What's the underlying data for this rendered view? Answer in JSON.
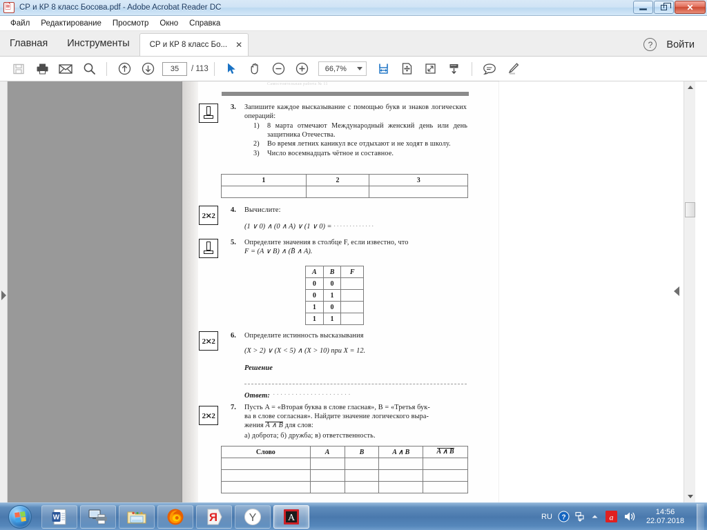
{
  "window": {
    "title": "СР и КР 8 класс Босова.pdf - Adobe Acrobat Reader DC",
    "app_icon": "pdf-document-icon",
    "minimize_label": "",
    "restore_label": "",
    "close_label": "✕"
  },
  "menu": {
    "items": [
      {
        "label": "Файл"
      },
      {
        "label": "Редактирование"
      },
      {
        "label": "Просмотр"
      },
      {
        "label": "Окно"
      },
      {
        "label": "Справка"
      }
    ]
  },
  "tabstrip": {
    "home_label": "Главная",
    "tools_label": "Инструменты",
    "document_tab_label": "СР и КР 8 класс Бо...",
    "document_tab_close": "✕",
    "help_label": "?",
    "signin_label": "Войти"
  },
  "toolbar": {
    "save_icon": "floppy-save-icon",
    "print_icon": "printer-icon",
    "email_icon": "envelope-icon",
    "search_icon": "magnifier-icon",
    "prev_page_icon": "arrow-up-circle-icon",
    "next_page_icon": "arrow-down-circle-icon",
    "page_number": "35",
    "page_total": "/ 113",
    "select_tool_icon": "cursor-arrow-icon",
    "hand_tool_icon": "hand-icon",
    "zoom_out_icon": "minus-circle-icon",
    "zoom_in_icon": "plus-circle-icon",
    "zoom_value": "66,7%",
    "zoom_caret_icon": "chevron-down-icon",
    "fit_width_icon": "fit-width-icon",
    "pan_page_icon": "pan-page-icon",
    "fit_page_icon": "fit-page-icon",
    "scroll_mode_icon": "scroll-mode-icon",
    "comment_icon": "comment-bubble-icon",
    "highlight_icon": "highlighter-pen-icon"
  },
  "viewer": {
    "nav_expand_icon": "triangle-right-icon",
    "right_collapse_icon": "triangle-left-icon",
    "scroll_up_icon": "triangle-up-icon",
    "scroll_down_icon": "triangle-down-icon"
  },
  "document": {
    "header_ghost": "Самостоятельная работа № 11",
    "questions": [
      {
        "number": "3.",
        "icon": "pen-exercise-icon",
        "intro": "Запишите каждое высказывание с помощью букв и знаков логических операций:",
        "items": [
          {
            "label": "1)",
            "text": "8 марта отмечают Международный женский день или день защитника Отечества."
          },
          {
            "label": "2)",
            "text": "Во время летних каникул все отдыхают и не ходят в школу."
          },
          {
            "label": "3)",
            "text": "Число восемнадцать чётное и составное."
          }
        ],
        "table": {
          "headers": [
            "1",
            "2",
            "3"
          ],
          "rows": [
            [
              "",
              "",
              ""
            ]
          ]
        }
      },
      {
        "number": "4.",
        "icon": "two-by-two-icon",
        "intro": "Вычислите:",
        "formula_prefix": "(1 ∨ 0) ∧ (0 ∧ A) ∨ (1 ∨ 0) =",
        "formula_blank": "·············"
      },
      {
        "number": "5.",
        "icon": "pen-exercise-icon",
        "intro": "Определите значения в столбце F, если известно, что",
        "formula": "F = (A ∨ B) ∧ (B̄ ∧ A).",
        "table": {
          "headers": [
            "A",
            "B",
            "F"
          ],
          "rows": [
            [
              "0",
              "0",
              ""
            ],
            [
              "0",
              "1",
              ""
            ],
            [
              "1",
              "0",
              ""
            ],
            [
              "1",
              "1",
              ""
            ]
          ]
        }
      },
      {
        "number": "6.",
        "icon": "two-by-two-icon",
        "intro": "Определите истинность высказывания",
        "formula": "(X > 2) ∨ (X < 5) ∧ (X > 10) при X = 12.",
        "solution_label": "Решение",
        "answer_label": "Ответ:",
        "answer_blank": "·····················"
      },
      {
        "number": "7.",
        "icon": "two-by-two-icon",
        "intro_line1": "Пусть A = «Вторая буква в слове гласная», B = «Третья бук-",
        "intro_line2": "ва в слове согласная». Найдите значение логического выра-",
        "intro_line3_pre": "жения ",
        "intro_line3_overline": "A ∧ B",
        "intro_line3_post": " для слов:",
        "options": "а) доброта;  б) дружба;  в) ответственность.",
        "table": {
          "headers": [
            "Слово",
            "A",
            "B",
            "A ∧ B",
            "A ∧ B"
          ],
          "rows": [
            [
              "",
              "",
              "",
              "",
              ""
            ],
            [
              "",
              "",
              "",
              "",
              ""
            ],
            [
              "",
              "",
              "",
              "",
              ""
            ]
          ]
        }
      }
    ]
  },
  "taskbar": {
    "start_label": "start-orb",
    "items": [
      {
        "name": "word-taskbar-item",
        "icon": "word-document-icon",
        "active": false
      },
      {
        "name": "printer-taskbar-item",
        "icon": "monitor-printer-icon",
        "active": false
      },
      {
        "name": "explorer-taskbar-item",
        "icon": "folder-icon",
        "active": false
      },
      {
        "name": "firefox-taskbar-item",
        "icon": "firefox-icon",
        "active": false
      },
      {
        "name": "yandex-browser-taskbar-item",
        "icon": "yandex-letter-icon",
        "active": false
      },
      {
        "name": "yandex-y-taskbar-item",
        "icon": "yandex-y-icon",
        "active": false
      },
      {
        "name": "acrobat-taskbar-item",
        "icon": "acrobat-reader-icon",
        "active": true
      }
    ],
    "tray": {
      "language": "RU",
      "action_center_icon": "help-blue-icon",
      "network_icon": "network-icon",
      "show_hidden_icon": "triangle-up-icon",
      "antivirus_icon": "avira-icon",
      "volume_icon": "speaker-icon",
      "time": "14:56",
      "date": "22.07.2018"
    }
  },
  "colors": {
    "titlebar_text": "#17365d",
    "accent_blue": "#1a72c4",
    "page_grey": "#999999",
    "taskbar_blue": "#4a79ad",
    "close_red": "#cc4a32"
  }
}
